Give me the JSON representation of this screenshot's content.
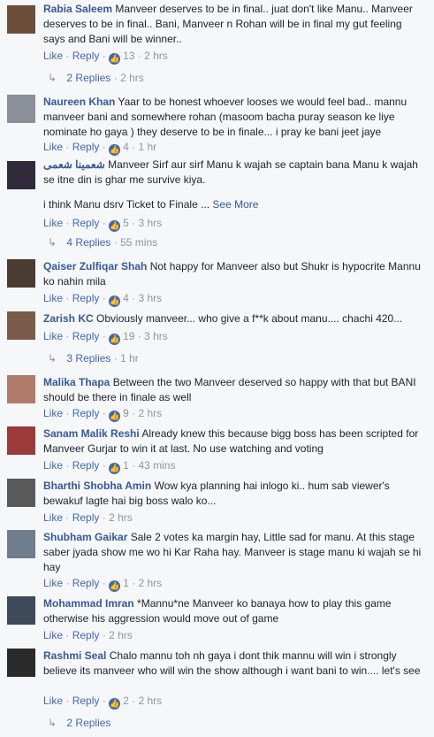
{
  "actions": {
    "like": "Like",
    "reply": "Reply",
    "dot": "·",
    "arrow": "↳"
  },
  "comments": [
    {
      "name": "Rabia Saleem",
      "text": "Manveer deserves to be in final.. juat don't like Manu.. Manveer deserves to be in final.. Bani, Manveer n Rohan will be in final my gut feeling says and Bani will be winner..",
      "likes": "13",
      "time": "2 hrs",
      "replies_label": "2 Replies",
      "replies_time": "2 hrs",
      "avatar_color": "#6b4f3a"
    },
    {
      "name": "Naureen Khan",
      "text": "Yaar to be honest whoever looses we would feel bad.. mannu manveer bani and somewhere rohan (masoom bacha puray season ke liye nominate ho gaya ) they deserve to be in finale... i pray ke bani jeet jaye",
      "likes": "4",
      "time": "1 hr",
      "avatar_color": "#8a8f99"
    },
    {
      "name": "شعمینا شعمی",
      "text": "Manveer Sirf aur sirf Manu k wajah se captain bana Manu k wajah se itne din is ghar me survive kiya.",
      "text2": "i think Manu dsrv Ticket to Finale ...",
      "see_more": "See More",
      "likes": "5",
      "time": "3 hrs",
      "replies_label": "4 Replies",
      "replies_time": "55 mins",
      "avatar_color": "#2f2b3a"
    },
    {
      "name": "Qaiser Zulfiqar Shah",
      "text": "Not happy for Manveer also but Shukr is hypocrite Mannu ko nahin mila",
      "likes": "4",
      "time": "3 hrs",
      "avatar_color": "#4a3c33"
    },
    {
      "name": "Zarish KC",
      "text": "Obviously manveer... who give a f**k about manu.... chachi 420...",
      "likes": "19",
      "time": "3 hrs",
      "replies_label": "3 Replies",
      "replies_time": "1 hr",
      "avatar_color": "#7a5c4a"
    },
    {
      "name": "Malika Thapa",
      "text": "Between the two Manveer deserved so happy with that but BANI should be there in finale as well",
      "likes": "9",
      "time": "2 hrs",
      "avatar_color": "#b07a6a"
    },
    {
      "name": "Sanam Malik Reshi",
      "text": "Already knew this because bigg boss has been scripted for Manveer Gurjar to win it at last. No use watching and voting",
      "likes": "1",
      "time": "43 mins",
      "avatar_color": "#9b3a3a"
    },
    {
      "name": "Bharthi Shobha Amin",
      "text": "Wow kya planning hai inlogo ki.. hum sab viewer's bewakuf lagte hai big boss walo ko...",
      "time": "2 hrs",
      "avatar_color": "#5a5a5a"
    },
    {
      "name": "Shubham Gaikar",
      "text": "Sale 2 votes ka margin hay, Little sad for manu. At this stage saber jyada show me wo hi Kar Raha hay. Manveer is stage manu ki wajah se hi hay",
      "likes": "1",
      "time": "2 hrs",
      "avatar_color": "#6f7d8c"
    },
    {
      "name": "Mohammad Imran",
      "text": "*Mannu*ne Manveer ko banaya how to play this game otherwise his aggression would move out of game",
      "time": "2 hrs",
      "avatar_color": "#3e4a5a"
    },
    {
      "name": "Rashmi Seal",
      "text": "Chalo mannu toh nh gaya i dont thik mannu will win i strongly believe its manveer who will win the show although i want bani to win.... let's see",
      "likes": "2",
      "time": "2 hrs",
      "replies_label": "2 Replies",
      "replies_time": "",
      "avatar_color": "#2a2a2a"
    }
  ]
}
